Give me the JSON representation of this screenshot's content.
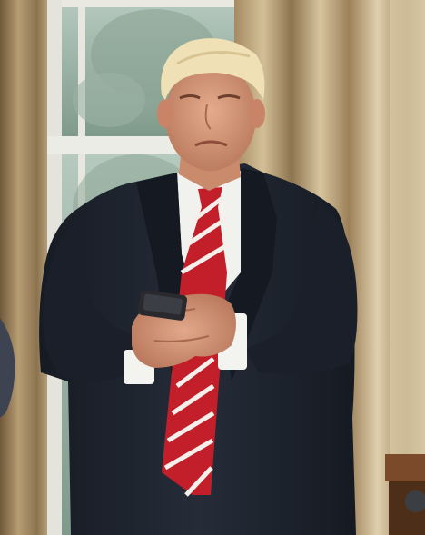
{
  "photo": {
    "colors": {
      "curtain_light": "#d8c6a3",
      "curtain_mid": "#b49a72",
      "curtain_dark": "#7e6746",
      "window_glass": "#9fb5a8",
      "window_frame": "#e6e6df",
      "suit": "#1f2530",
      "suit_shadow": "#141920",
      "shirt": "#f2f2f0",
      "tie_red": "#c21f2a",
      "tie_stripe": "#f4f0ec",
      "skin": "#d89a7a",
      "hair": "#efe0b6",
      "phone": "#2a2a2e",
      "table": "#7a4a2a"
    }
  }
}
